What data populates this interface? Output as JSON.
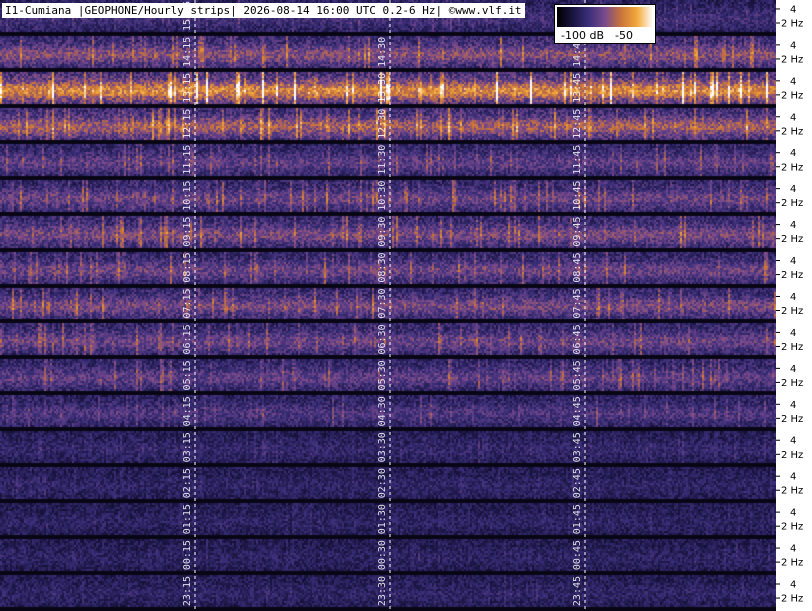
{
  "title": "I1-Cumiana |GEOPHONE/Hourly strips| 2026-08-14 16:00 UTC 0.2-6 Hz| ©www.vlf.it",
  "colorbar": {
    "labels": [
      "-100 dB",
      "-50"
    ],
    "colors": [
      "#000000",
      "#1a1440",
      "#3b2f7a",
      "#7a4a8c",
      "#c9733a",
      "#f3a93a",
      "#ffffff"
    ]
  },
  "chart_data": {
    "type": "heatmap",
    "title": "I1-Cumiana |GEOPHONE/Hourly strips| 2026-08-14 16:00 UTC 0.2-6 Hz| ©www.vlf.it",
    "colorbar_range_db": [
      -100,
      -50
    ],
    "y_ticks_per_strip": [
      "4",
      "2 Hz"
    ],
    "strips": [
      {
        "labels": [
          "15:15"
        ],
        "intensity": 0.35
      },
      {
        "labels": [
          "14:15",
          "14:30",
          "14:45"
        ],
        "intensity": 0.65
      },
      {
        "labels": [
          "13:15",
          "13:30",
          "13:45"
        ],
        "intensity": 0.95
      },
      {
        "labels": [
          "12:15",
          "12:30",
          "12:45"
        ],
        "intensity": 0.75
      },
      {
        "labels": [
          "11:15",
          "11:30",
          "11:45"
        ],
        "intensity": 0.5
      },
      {
        "labels": [
          "10:15",
          "10:30",
          "10:45"
        ],
        "intensity": 0.55
      },
      {
        "labels": [
          "09:15",
          "09:30",
          "09:45"
        ],
        "intensity": 0.6
      },
      {
        "labels": [
          "08:15",
          "08:30",
          "08:45"
        ],
        "intensity": 0.55
      },
      {
        "labels": [
          "07:15",
          "07:30",
          "07:45"
        ],
        "intensity": 0.6
      },
      {
        "labels": [
          "06:15",
          "06:30",
          "06:45"
        ],
        "intensity": 0.55
      },
      {
        "labels": [
          "05:15",
          "05:30",
          "05:45"
        ],
        "intensity": 0.5
      },
      {
        "labels": [
          "04:15",
          "04:30",
          "04:45"
        ],
        "intensity": 0.42
      },
      {
        "labels": [
          "03:15",
          "03:30",
          "03:45"
        ],
        "intensity": 0.25
      },
      {
        "labels": [
          "02:15",
          "02:30",
          "02:45"
        ],
        "intensity": 0.22
      },
      {
        "labels": [
          "01:15",
          "01:30",
          "01:45"
        ],
        "intensity": 0.2
      },
      {
        "labels": [
          "00:15",
          "00:30",
          "00:45"
        ],
        "intensity": 0.2
      },
      {
        "labels": [
          "23:15",
          "23:30",
          "23:45"
        ],
        "intensity": 0.22
      }
    ]
  }
}
